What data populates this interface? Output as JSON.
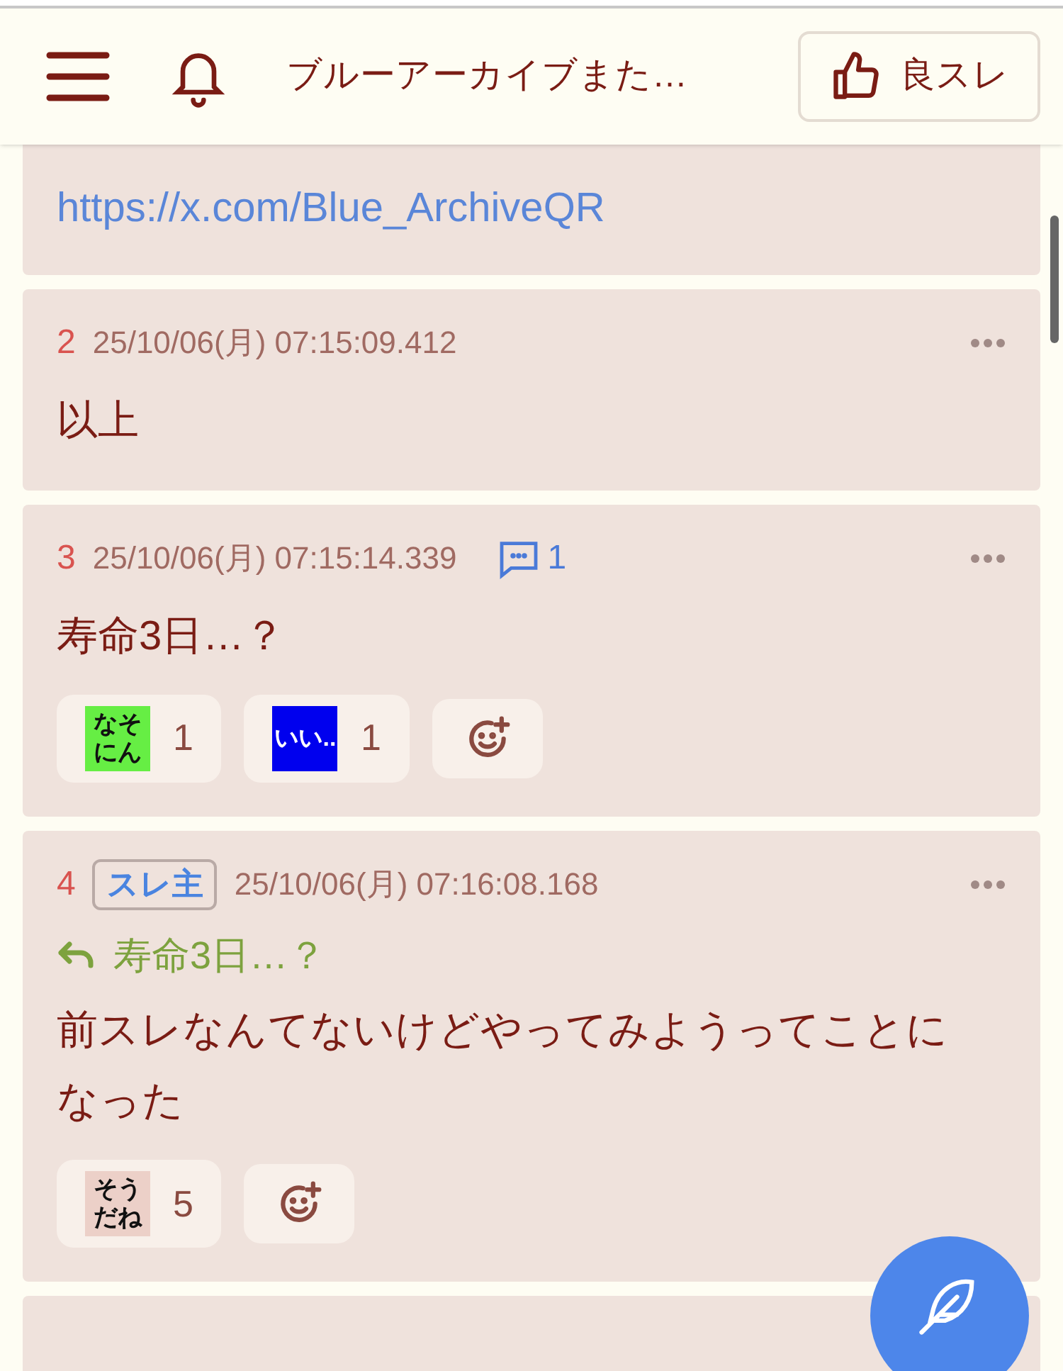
{
  "header": {
    "title": "ブルーアーカイブまた…",
    "like_button": "良スレ"
  },
  "posts": [
    {
      "kind": "partial",
      "link": "https://x.com/Blue_ArchiveQR"
    },
    {
      "kind": "post",
      "number": "2",
      "date": "25/10/06(月) 07:15:09.412",
      "body": "以上"
    },
    {
      "kind": "post",
      "number": "3",
      "date": "25/10/06(月) 07:15:14.339",
      "reply_count": "1",
      "body": "寿命3日…？",
      "reactions": [
        {
          "stamp": "なそにん",
          "color": "#66ee44",
          "count": "1"
        },
        {
          "stamp": "いい..",
          "color": "#0000ee",
          "count": "1"
        }
      ]
    },
    {
      "kind": "post",
      "number": "4",
      "badge": "スレ主",
      "date": "25/10/06(月) 07:16:08.168",
      "quote": "寿命3日…？",
      "body": "前スレなんてないけどやってみようってことになった",
      "reactions": [
        {
          "stamp": "そうだね",
          "color": "#ecd0c8",
          "count": "5"
        }
      ]
    },
    {
      "kind": "empty"
    }
  ]
}
